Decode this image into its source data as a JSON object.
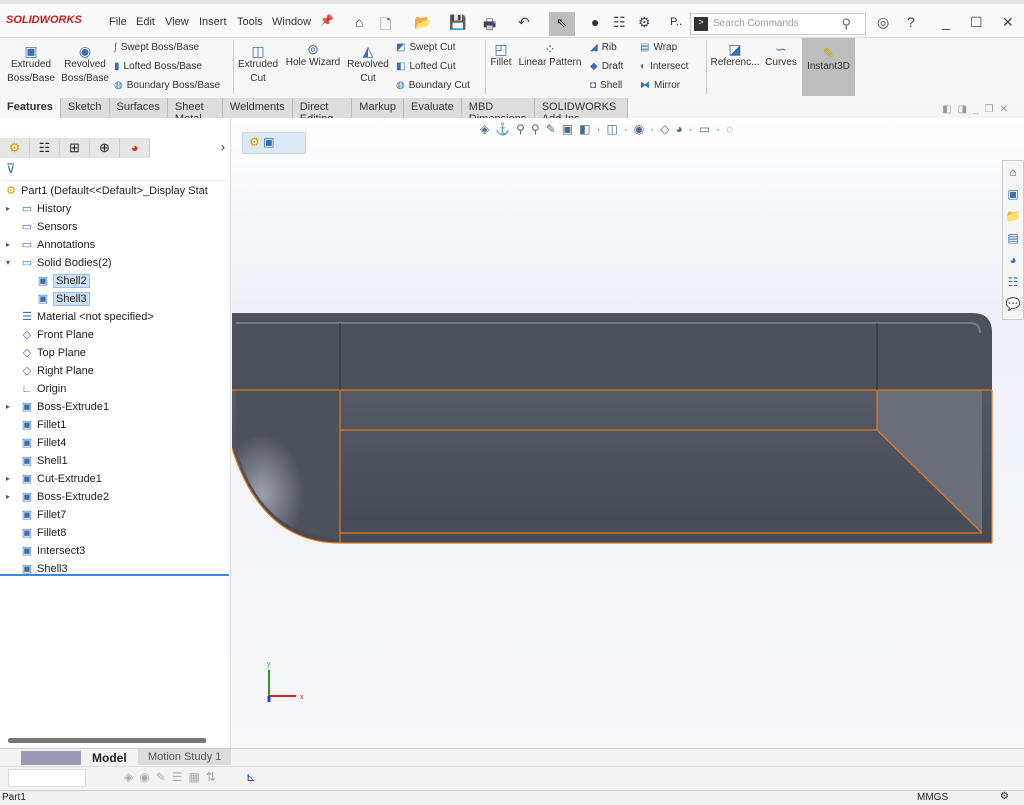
{
  "app": {
    "logo": "SOLIDWORKS",
    "brand_color": "#d01c1c"
  },
  "menu": [
    "File",
    "Edit",
    "View",
    "Insert",
    "Tools",
    "Window"
  ],
  "search": {
    "placeholder": "Search Commands"
  },
  "quick": {
    "truncated": "P.."
  },
  "command_manager": {
    "large": [
      {
        "label": "Extruded Boss/Base",
        "icon": "extrude-icon"
      },
      {
        "label": "Revolved Boss/Base",
        "icon": "revolve-icon"
      },
      {
        "label": "Extruded Cut",
        "icon": "extrude-cut-icon"
      },
      {
        "label": "Hole Wizard",
        "icon": "hole-wizard-icon"
      },
      {
        "label": "Revolved Cut",
        "icon": "revolve-cut-icon"
      },
      {
        "label": "Fillet",
        "icon": "fillet-icon"
      },
      {
        "label": "Linear Pattern",
        "icon": "linear-pattern-icon"
      },
      {
        "label": "Referenc...",
        "icon": "reference-icon"
      },
      {
        "label": "Curves",
        "icon": "curves-icon"
      },
      {
        "label": "Instant3D",
        "icon": "instant3d-icon"
      }
    ],
    "small": [
      "Swept Boss/Base",
      "Lofted Boss/Base",
      "Boundary Boss/Base",
      "Swept Cut",
      "Lofted Cut",
      "Boundary Cut",
      "Rib",
      "Draft",
      "Shell",
      "Wrap",
      "Intersect",
      "Mirror"
    ]
  },
  "tabs": [
    "Features",
    "Sketch",
    "Surfaces",
    "Sheet Metal",
    "Weldments",
    "Direct Editing",
    "Markup",
    "Evaluate",
    "MBD Dimensions",
    "SOLIDWORKS Add-Ins"
  ],
  "tree": [
    {
      "label": "Part1  (Default<<Default>_Display Stat",
      "icon": "part-icon",
      "level": 0
    },
    {
      "label": "History",
      "icon": "folder-icon",
      "level": 1,
      "arrow": "▸"
    },
    {
      "label": "Sensors",
      "icon": "folder-icon",
      "level": 1
    },
    {
      "label": "Annotations",
      "icon": "folder-icon",
      "level": 1,
      "arrow": "▸"
    },
    {
      "label": "Solid Bodies(2)",
      "icon": "folder-icon",
      "level": 1,
      "arrow": "▾"
    },
    {
      "label": "Shell2",
      "icon": "body-icon",
      "level": 2,
      "selected": true
    },
    {
      "label": "Shell3",
      "icon": "body-icon",
      "level": 2,
      "selected": true
    },
    {
      "label": "Material <not specified>",
      "icon": "material-icon",
      "level": 1
    },
    {
      "label": "Front Plane",
      "icon": "plane-icon",
      "level": 1
    },
    {
      "label": "Top Plane",
      "icon": "plane-icon",
      "level": 1
    },
    {
      "label": "Right Plane",
      "icon": "plane-icon",
      "level": 1
    },
    {
      "label": "Origin",
      "icon": "origin-icon",
      "level": 1
    },
    {
      "label": "Boss-Extrude1",
      "icon": "feature-icon",
      "level": 1,
      "arrow": "▸"
    },
    {
      "label": "Fillet1",
      "icon": "feature-icon",
      "level": 1
    },
    {
      "label": "Fillet4",
      "icon": "feature-icon",
      "level": 1
    },
    {
      "label": "Shell1",
      "icon": "feature-icon",
      "level": 1
    },
    {
      "label": "Cut-Extrude1",
      "icon": "feature-icon",
      "level": 1,
      "arrow": "▸"
    },
    {
      "label": "Boss-Extrude2",
      "icon": "feature-icon",
      "level": 1,
      "arrow": "▸"
    },
    {
      "label": "Fillet7",
      "icon": "feature-icon",
      "level": 1
    },
    {
      "label": "Fillet8",
      "icon": "feature-icon",
      "level": 1
    },
    {
      "label": "Intersect3",
      "icon": "feature-icon",
      "level": 1
    },
    {
      "label": "Shell3",
      "icon": "feature-icon",
      "level": 1
    }
  ],
  "bottom_tabs": [
    "Model",
    "Motion Study 1"
  ],
  "status": {
    "doc": "Part1",
    "units": "MMGS"
  },
  "triad": {
    "x": "x",
    "y": "y"
  },
  "colors": {
    "model": "#4f535e",
    "edge": "#e07b1f",
    "accent": "#3a6fb0"
  }
}
